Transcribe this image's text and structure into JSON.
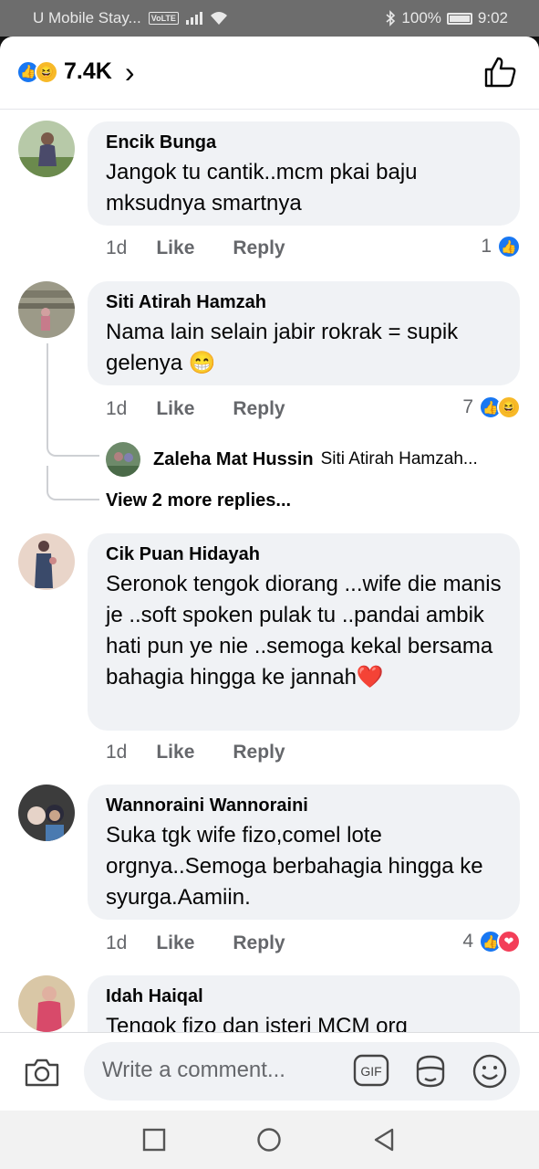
{
  "status_bar": {
    "carrier": "U Mobile Stay...",
    "network_badge": "VoLTE",
    "battery": "100%",
    "time": "9:02"
  },
  "header": {
    "reaction_count": "7.4K"
  },
  "comments": [
    {
      "name": "Encik Bunga",
      "text": "Jangok tu cantik..mcm pkai baju mksudnya smartnya",
      "time": "1d",
      "like": "Like",
      "reply": "Reply",
      "reactions": {
        "count": "1",
        "icons": [
          "like-icon"
        ]
      }
    },
    {
      "name": "Siti Atirah Hamzah",
      "text": "Nama lain selain jabir rokrak = supik gelenya 😁",
      "time": "1d",
      "like": "Like",
      "reply": "Reply",
      "reactions": {
        "count": "7",
        "icons": [
          "like-icon",
          "haha-icon"
        ]
      },
      "reply_preview": {
        "name": "Zaleha Mat Hussin",
        "snippet": "Siti Atirah Hamzah..."
      },
      "more_replies": "View 2 more replies..."
    },
    {
      "name": "Cik Puan Hidayah",
      "text": "Seronok tengok diorang ...wife die manis je ..soft spoken pulak tu ..pandai ambik hati pun ye nie ..semoga kekal bersama bahagia hingga ke jannah❤️",
      "time": "1d",
      "like": "Like",
      "reply": "Reply"
    },
    {
      "name": "Wannoraini Wannoraini",
      "text": "Suka tgk wife fizo,comel lote orgnya..Semoga berbahagia hingga ke syurga.Aamiin.",
      "time": "1d",
      "like": "Like",
      "reply": "Reply",
      "reactions": {
        "count": "4",
        "icons": [
          "like-icon",
          "love-icon"
        ]
      }
    },
    {
      "name": "Idah Haiqal",
      "text": "Tengok fizo dan isteri MCM org"
    }
  ],
  "composer": {
    "placeholder": "Write a comment...",
    "gif_label": "GIF"
  },
  "colors": {
    "like_blue": "#1877f2",
    "love_red": "#f33e58",
    "haha_yellow": "#f7b928",
    "bubble_gray": "#f0f2f5",
    "secondary_text": "#65676b"
  }
}
